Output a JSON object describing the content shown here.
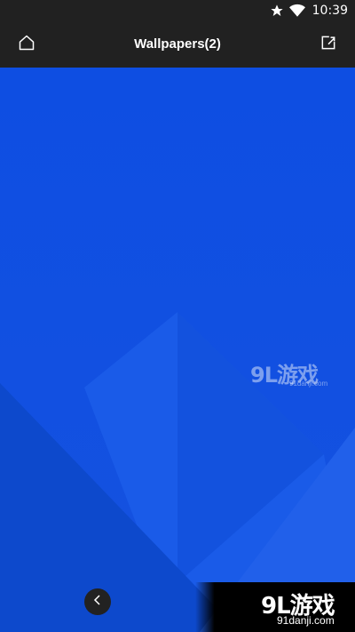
{
  "status_bar": {
    "time": "10:39",
    "icons": [
      "star-icon",
      "wifi-icon"
    ]
  },
  "app_bar": {
    "title": "Wallpapers(2)",
    "left_icon": "home-icon",
    "right_icon": "share-icon"
  },
  "wallpaper": {
    "background_color": "#0d4fe0",
    "watermark": {
      "logo_text": "9L游戏",
      "url_text": "91danji.com"
    }
  },
  "bottom_logo": {
    "logo_text": "9L游戏",
    "url_text": "91danji.com"
  },
  "navigation": {
    "back_icon": "chevron-left-icon"
  }
}
